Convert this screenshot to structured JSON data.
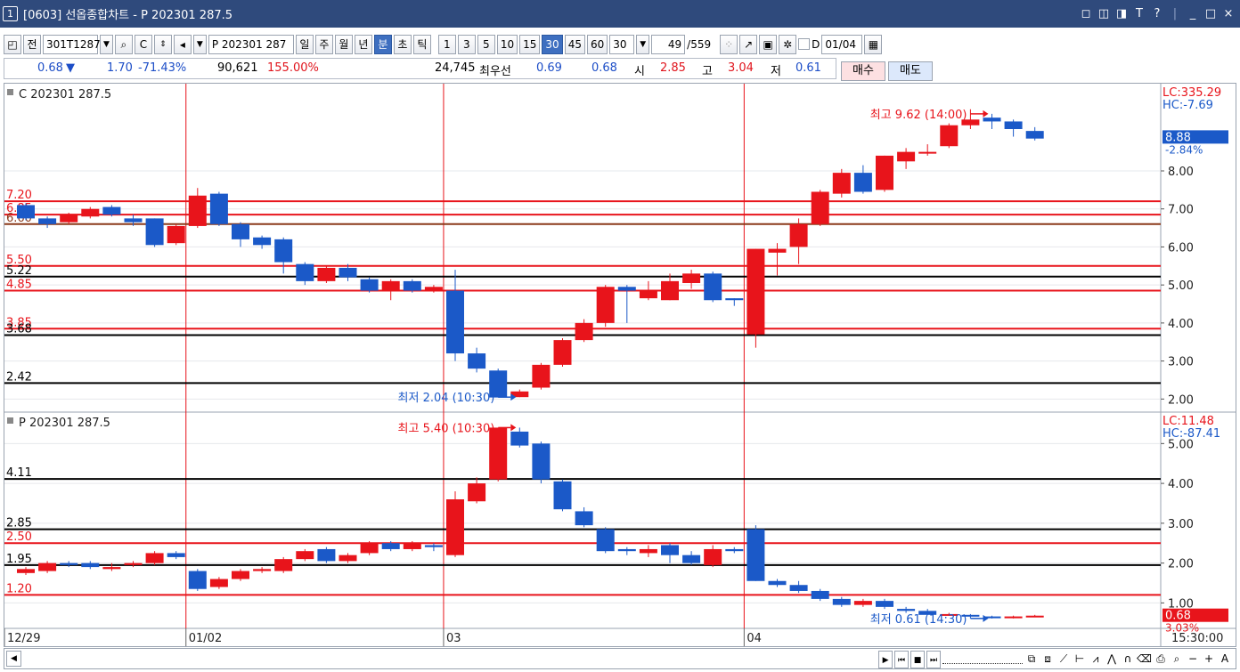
{
  "window": {
    "number": "1",
    "title": "[0603] 선옵종합차트 - P 202301 287.5",
    "controls": [
      "◻",
      "◫",
      "◨",
      "T",
      "?",
      "_",
      "□",
      "×"
    ]
  },
  "toolbar": {
    "prev_label": "전",
    "code": "301T1287",
    "search_icon": "🔍",
    "symbol_name": "P 202301 287",
    "periods": [
      "일",
      "주",
      "월",
      "년",
      "분",
      "초",
      "틱"
    ],
    "active_period": "분",
    "intervals": [
      "1",
      "3",
      "5",
      "10",
      "15",
      "30",
      "45",
      "60"
    ],
    "active_interval": "30",
    "interval_value": "30",
    "count_display": "49",
    "count_total": "/559",
    "d_label": "D",
    "date_value": "01/04"
  },
  "infobar": {
    "price": "0.68",
    "change_arrow": "▼",
    "change": "1.70",
    "change_pct": "-71.43%",
    "volume": "90,621",
    "volume_pct": "155.00%",
    "open_interest": "24,745",
    "best_label": "최우선",
    "best_ask": "0.69",
    "best_bid": "0.68",
    "open_label": "시",
    "open": "2.85",
    "high_label": "고",
    "high": "3.04",
    "low_label": "저",
    "low": "0.61",
    "buy_button": "매수",
    "sell_button": "매도"
  },
  "colors": {
    "up": "#e8141b",
    "down": "#1b59c8",
    "titlebar": "#2f4a7c"
  },
  "panes": [
    {
      "label": "C 202301 287.5",
      "lc": "LC:335.29",
      "hc": "HC:-7.69",
      "ylim": [
        1.75,
        10.2
      ],
      "y_ticks": [
        2.0,
        3.0,
        4.0,
        5.0,
        6.0,
        7.0,
        8.0
      ],
      "y_tick_labels": [
        "2.00",
        "3.00",
        "4.00",
        "5.00",
        "6.00",
        "7.00",
        "8.00"
      ],
      "current_price": "8.88",
      "current_value": 8.88,
      "current_pct": "-2.84%",
      "high_annotation": "최고 9.62 (14:00)",
      "high_index": 45,
      "low_annotation": "최저 2.04 (10:30)",
      "low_index": 23,
      "hlines": [
        {
          "value": 7.2,
          "label": "7.20",
          "color": "#e8141b"
        },
        {
          "value": 6.85,
          "label": "6.85",
          "color": "#e8141b"
        },
        {
          "value": 6.6,
          "label": "6.60",
          "color": "#8b3a1a"
        },
        {
          "value": 5.5,
          "label": "5.50",
          "color": "#e8141b"
        },
        {
          "value": 5.22,
          "label": "5.22",
          "color": "#000000"
        },
        {
          "value": 4.85,
          "label": "4.85",
          "color": "#e8141b"
        },
        {
          "value": 3.85,
          "label": "3.85",
          "color": "#e8141b"
        },
        {
          "value": 3.68,
          "label": "3.68",
          "color": "#000000"
        },
        {
          "value": 2.42,
          "label": "2.42",
          "color": "#000000"
        }
      ],
      "candles": [
        [
          7.1,
          6.75,
          7.15,
          6.7
        ],
        [
          6.75,
          6.6,
          6.8,
          6.5
        ],
        [
          6.65,
          6.85,
          6.9,
          6.6
        ],
        [
          6.8,
          7.0,
          7.05,
          6.75
        ],
        [
          7.05,
          6.85,
          7.1,
          6.8
        ],
        [
          6.75,
          6.65,
          6.85,
          6.55
        ],
        [
          6.75,
          6.05,
          6.75,
          6.0
        ],
        [
          6.1,
          6.55,
          6.6,
          6.05
        ],
        [
          6.55,
          7.35,
          7.55,
          6.5
        ],
        [
          7.4,
          6.6,
          7.45,
          6.55
        ],
        [
          6.6,
          6.2,
          6.65,
          6.0
        ],
        [
          6.25,
          6.05,
          6.3,
          5.95
        ],
        [
          6.2,
          5.6,
          6.25,
          5.3
        ],
        [
          5.55,
          5.1,
          5.6,
          5.0
        ],
        [
          5.1,
          5.45,
          5.5,
          5.05
        ],
        [
          5.45,
          5.2,
          5.55,
          5.1
        ],
        [
          5.15,
          4.85,
          5.2,
          4.8
        ],
        [
          4.85,
          5.1,
          5.15,
          4.6
        ],
        [
          5.1,
          4.85,
          5.15,
          4.8
        ],
        [
          4.85,
          4.95,
          5.0,
          4.8
        ],
        [
          4.85,
          3.2,
          5.4,
          3.0
        ],
        [
          3.2,
          2.8,
          3.35,
          2.7
        ],
        [
          2.75,
          2.04,
          2.8,
          2.04
        ],
        [
          2.05,
          2.2,
          2.25,
          2.05
        ],
        [
          2.3,
          2.9,
          2.95,
          2.25
        ],
        [
          2.9,
          3.55,
          3.6,
          2.85
        ],
        [
          3.55,
          4.0,
          4.1,
          3.5
        ],
        [
          4.0,
          4.95,
          5.0,
          3.9
        ],
        [
          4.95,
          4.85,
          5.0,
          4.0
        ],
        [
          4.65,
          4.85,
          5.1,
          4.6
        ],
        [
          4.6,
          5.1,
          5.3,
          4.6
        ],
        [
          5.05,
          5.3,
          5.4,
          4.9
        ],
        [
          5.3,
          4.6,
          5.35,
          4.55
        ],
        [
          4.65,
          4.6,
          4.65,
          4.45
        ],
        [
          3.7,
          5.95,
          5.95,
          3.35
        ],
        [
          5.85,
          5.95,
          6.1,
          5.25
        ],
        [
          6.0,
          6.6,
          6.75,
          5.55
        ],
        [
          6.6,
          7.45,
          7.5,
          6.55
        ],
        [
          7.4,
          7.95,
          8.05,
          7.3
        ],
        [
          7.95,
          7.45,
          8.15,
          7.4
        ],
        [
          7.5,
          8.4,
          8.4,
          7.45
        ],
        [
          8.25,
          8.5,
          8.6,
          8.05
        ],
        [
          8.5,
          8.5,
          8.7,
          8.4
        ],
        [
          8.65,
          9.2,
          9.25,
          8.6
        ],
        [
          9.2,
          9.35,
          9.62,
          9.1
        ],
        [
          9.4,
          9.3,
          9.5,
          9.1
        ],
        [
          9.3,
          9.1,
          9.35,
          8.9
        ],
        [
          9.05,
          8.85,
          9.15,
          8.8
        ]
      ]
    },
    {
      "label": "P 202301 287.5",
      "lc": "LC:11.48",
      "hc": "HC:-87.41",
      "ylim": [
        0.45,
        5.7
      ],
      "y_ticks": [
        1.0,
        2.0,
        3.0,
        4.0,
        5.0
      ],
      "y_tick_labels": [
        "1.00",
        "2.00",
        "3.00",
        "4.00",
        "5.00"
      ],
      "current_price": "0.68",
      "current_value": 0.68,
      "current_pct": "3.03%",
      "high_annotation": "최고 5.40 (10:30)",
      "high_index": 23,
      "low_annotation": "최저 0.61 (14:30)",
      "low_index": 45,
      "hlines": [
        {
          "value": 4.11,
          "label": "4.11",
          "color": "#000000"
        },
        {
          "value": 2.85,
          "label": "2.85",
          "color": "#000000"
        },
        {
          "value": 2.5,
          "label": "2.50",
          "color": "#e8141b"
        },
        {
          "value": 1.95,
          "label": "1.95",
          "color": "#000000"
        },
        {
          "value": 1.2,
          "label": "1.20",
          "color": "#e8141b"
        }
      ],
      "candles": [
        [
          1.75,
          1.85,
          1.9,
          1.7
        ],
        [
          1.8,
          2.0,
          2.05,
          1.75
        ],
        [
          2.0,
          1.95,
          2.05,
          1.9
        ],
        [
          2.0,
          1.9,
          2.05,
          1.85
        ],
        [
          1.85,
          1.9,
          2.0,
          1.8
        ],
        [
          1.95,
          2.0,
          2.05,
          1.9
        ],
        [
          2.0,
          2.25,
          2.3,
          1.95
        ],
        [
          2.25,
          2.15,
          2.3,
          2.1
        ],
        [
          1.8,
          1.35,
          1.85,
          1.3
        ],
        [
          1.4,
          1.6,
          1.65,
          1.35
        ],
        [
          1.6,
          1.8,
          1.85,
          1.55
        ],
        [
          1.8,
          1.85,
          1.9,
          1.75
        ],
        [
          1.8,
          2.1,
          2.15,
          1.75
        ],
        [
          2.1,
          2.3,
          2.35,
          2.05
        ],
        [
          2.35,
          2.05,
          2.4,
          2.0
        ],
        [
          2.05,
          2.2,
          2.25,
          2.0
        ],
        [
          2.25,
          2.5,
          2.55,
          2.2
        ],
        [
          2.5,
          2.35,
          2.55,
          2.3
        ],
        [
          2.35,
          2.5,
          2.55,
          2.3
        ],
        [
          2.45,
          2.4,
          2.5,
          2.3
        ],
        [
          2.2,
          3.6,
          3.8,
          2.15
        ],
        [
          3.55,
          4.0,
          4.15,
          3.5
        ],
        [
          4.1,
          5.4,
          5.4,
          4.05
        ],
        [
          5.3,
          4.95,
          5.4,
          4.9
        ],
        [
          5.0,
          4.1,
          5.05,
          4.0
        ],
        [
          4.05,
          3.35,
          4.1,
          3.3
        ],
        [
          3.3,
          2.95,
          3.4,
          2.9
        ],
        [
          2.85,
          2.3,
          2.9,
          2.25
        ],
        [
          2.35,
          2.3,
          2.4,
          2.2
        ],
        [
          2.25,
          2.35,
          2.45,
          2.15
        ],
        [
          2.45,
          2.2,
          2.5,
          2.0
        ],
        [
          2.2,
          2.0,
          2.3,
          1.95
        ],
        [
          1.95,
          2.35,
          2.45,
          1.9
        ],
        [
          2.35,
          2.3,
          2.4,
          2.25
        ],
        [
          2.85,
          1.55,
          2.95,
          1.55
        ],
        [
          1.55,
          1.45,
          1.6,
          1.4
        ],
        [
          1.45,
          1.3,
          1.55,
          1.25
        ],
        [
          1.3,
          1.1,
          1.35,
          1.05
        ],
        [
          1.1,
          0.95,
          1.15,
          0.9
        ],
        [
          0.95,
          1.05,
          1.1,
          0.9
        ],
        [
          1.05,
          0.9,
          1.1,
          0.85
        ],
        [
          0.85,
          0.8,
          0.9,
          0.75
        ],
        [
          0.8,
          0.7,
          0.85,
          0.7
        ],
        [
          0.7,
          0.72,
          0.75,
          0.68
        ],
        [
          0.7,
          0.66,
          0.72,
          0.61
        ],
        [
          0.66,
          0.65,
          0.68,
          0.61
        ],
        [
          0.63,
          0.66,
          0.68,
          0.61
        ],
        [
          0.66,
          0.68,
          0.7,
          0.64
        ]
      ]
    }
  ],
  "x_axis": {
    "labels": [
      {
        "text": "12/29",
        "index": 0
      },
      {
        "text": "01/02",
        "index": 8
      },
      {
        "text": "03",
        "index": 20
      },
      {
        "text": "04",
        "index": 34
      }
    ],
    "time": "15:30:00"
  }
}
